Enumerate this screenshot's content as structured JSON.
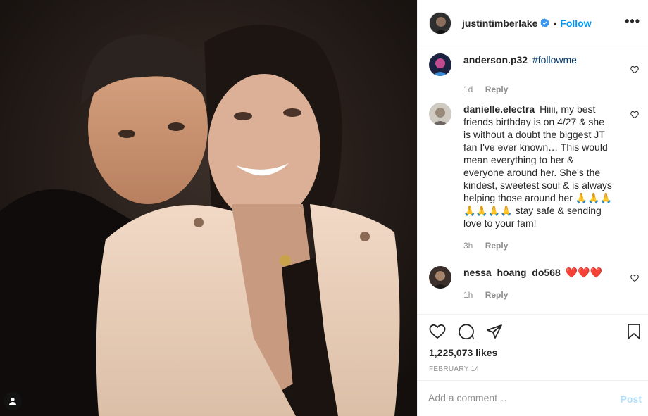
{
  "post": {
    "author": "justintimberlake",
    "verified": true,
    "follow_label": "Follow",
    "separator": "•",
    "more_icon": "more-options-icon",
    "likes": "1,225,073 likes",
    "date": "FEBRUARY 14"
  },
  "comments": [
    {
      "user": "anderson.p32",
      "tag": "#followme",
      "text": "",
      "time": "1d",
      "reply_label": "Reply"
    },
    {
      "user": "danielle.electra",
      "tag": "",
      "text": "Hiiii, my best friends birthday is on 4/27 & she is without a doubt the biggest JT fan I've ever known… This would mean everything to her & everyone around her. She's the kindest, sweetest soul & is always helping those around her 🙏🙏🙏🙏🙏🙏🙏 stay safe & sending love to your fam!",
      "time": "3h",
      "reply_label": "Reply"
    },
    {
      "user": "nessa_hoang_do568",
      "tag": "",
      "text": "❤️❤️❤️",
      "time": "1h",
      "reply_label": "Reply"
    }
  ],
  "composer": {
    "placeholder": "Add a comment…",
    "post_label": "Post"
  },
  "colors": {
    "accent": "#0095f6",
    "link": "#00376b",
    "muted": "#8e8e8e",
    "post_disabled": "#b2dffc"
  }
}
